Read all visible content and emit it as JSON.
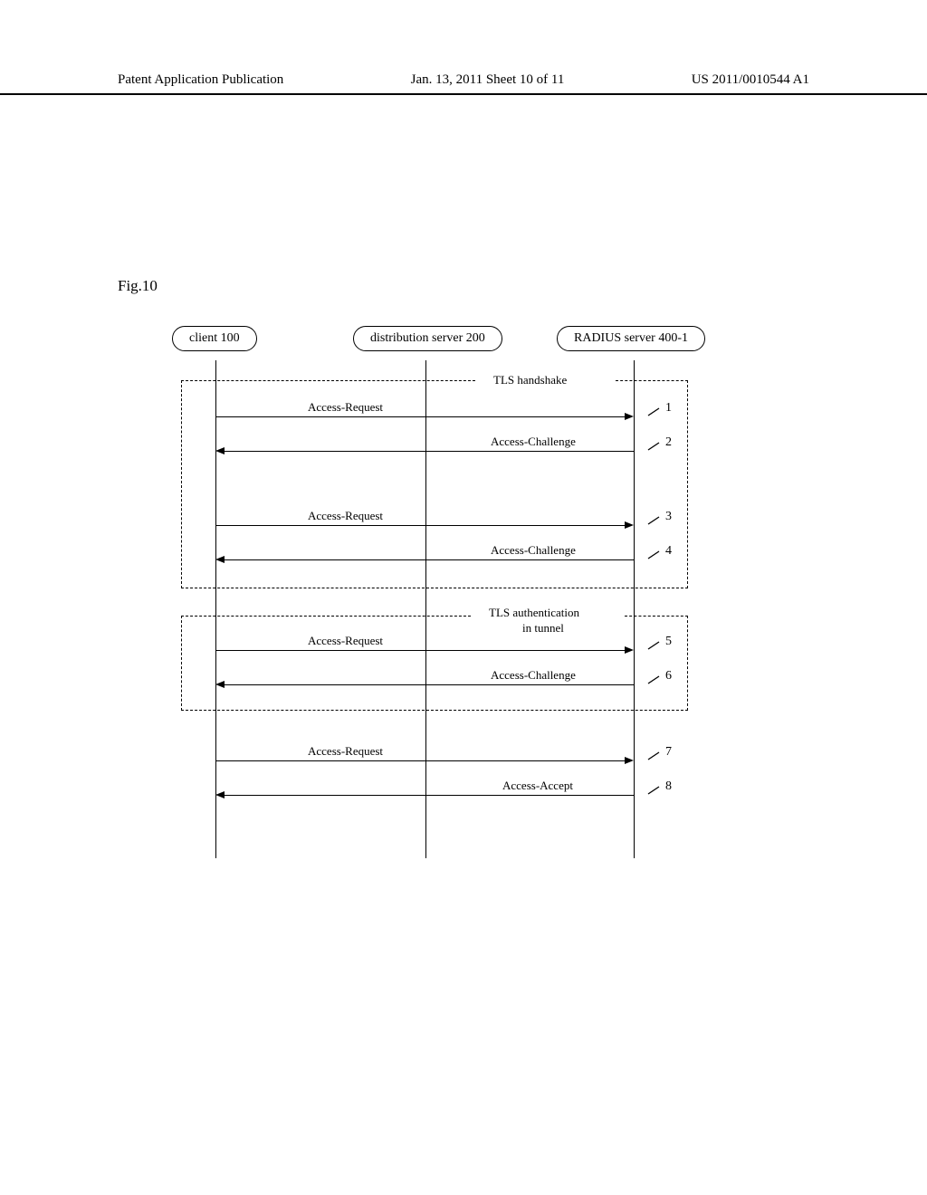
{
  "header": {
    "left": "Patent Application Publication",
    "center": "Jan. 13, 2011  Sheet 10 of 11",
    "right": "US 2011/0010544 A1"
  },
  "figure_label": "Fig.10",
  "participants": {
    "client": "client 100",
    "dist": "distribution server 200",
    "radius": "RADIUS server  400-1"
  },
  "phases": {
    "handshake": "TLS handshake",
    "auth": "TLS authentication",
    "auth2": "in tunnel"
  },
  "messages": {
    "m1": "Access-Request",
    "m2": "Access-Challenge",
    "m3": "Access-Request",
    "m4": "Access-Challenge",
    "m5": "Access-Request",
    "m6": "Access-Challenge",
    "m7": "Access-Request",
    "m8": "Access-Accept"
  },
  "steps": {
    "s1": "1",
    "s2": "2",
    "s3": "3",
    "s4": "4",
    "s5": "5",
    "s6": "6",
    "s7": "7",
    "s8": "8"
  },
  "chart_data": {
    "type": "sequence-diagram",
    "participants": [
      "client 100",
      "distribution server 200",
      "RADIUS server 400-1"
    ],
    "phases": [
      {
        "name": "TLS handshake",
        "steps": [
          1,
          2,
          3,
          4
        ]
      },
      {
        "name": "TLS authentication in tunnel",
        "steps": [
          5,
          6
        ]
      }
    ],
    "messages": [
      {
        "step": 1,
        "from": "client 100",
        "to": "RADIUS server 400-1",
        "label": "Access-Request"
      },
      {
        "step": 2,
        "from": "RADIUS server 400-1",
        "to": "client 100",
        "label": "Access-Challenge"
      },
      {
        "step": 3,
        "from": "client 100",
        "to": "RADIUS server 400-1",
        "label": "Access-Request"
      },
      {
        "step": 4,
        "from": "RADIUS server 400-1",
        "to": "client 100",
        "label": "Access-Challenge"
      },
      {
        "step": 5,
        "from": "client 100",
        "to": "RADIUS server 400-1",
        "label": "Access-Request"
      },
      {
        "step": 6,
        "from": "RADIUS server 400-1",
        "to": "client 100",
        "label": "Access-Challenge"
      },
      {
        "step": 7,
        "from": "client 100",
        "to": "RADIUS server 400-1",
        "label": "Access-Request"
      },
      {
        "step": 8,
        "from": "RADIUS server 400-1",
        "to": "client 100",
        "label": "Access-Accept"
      }
    ]
  }
}
